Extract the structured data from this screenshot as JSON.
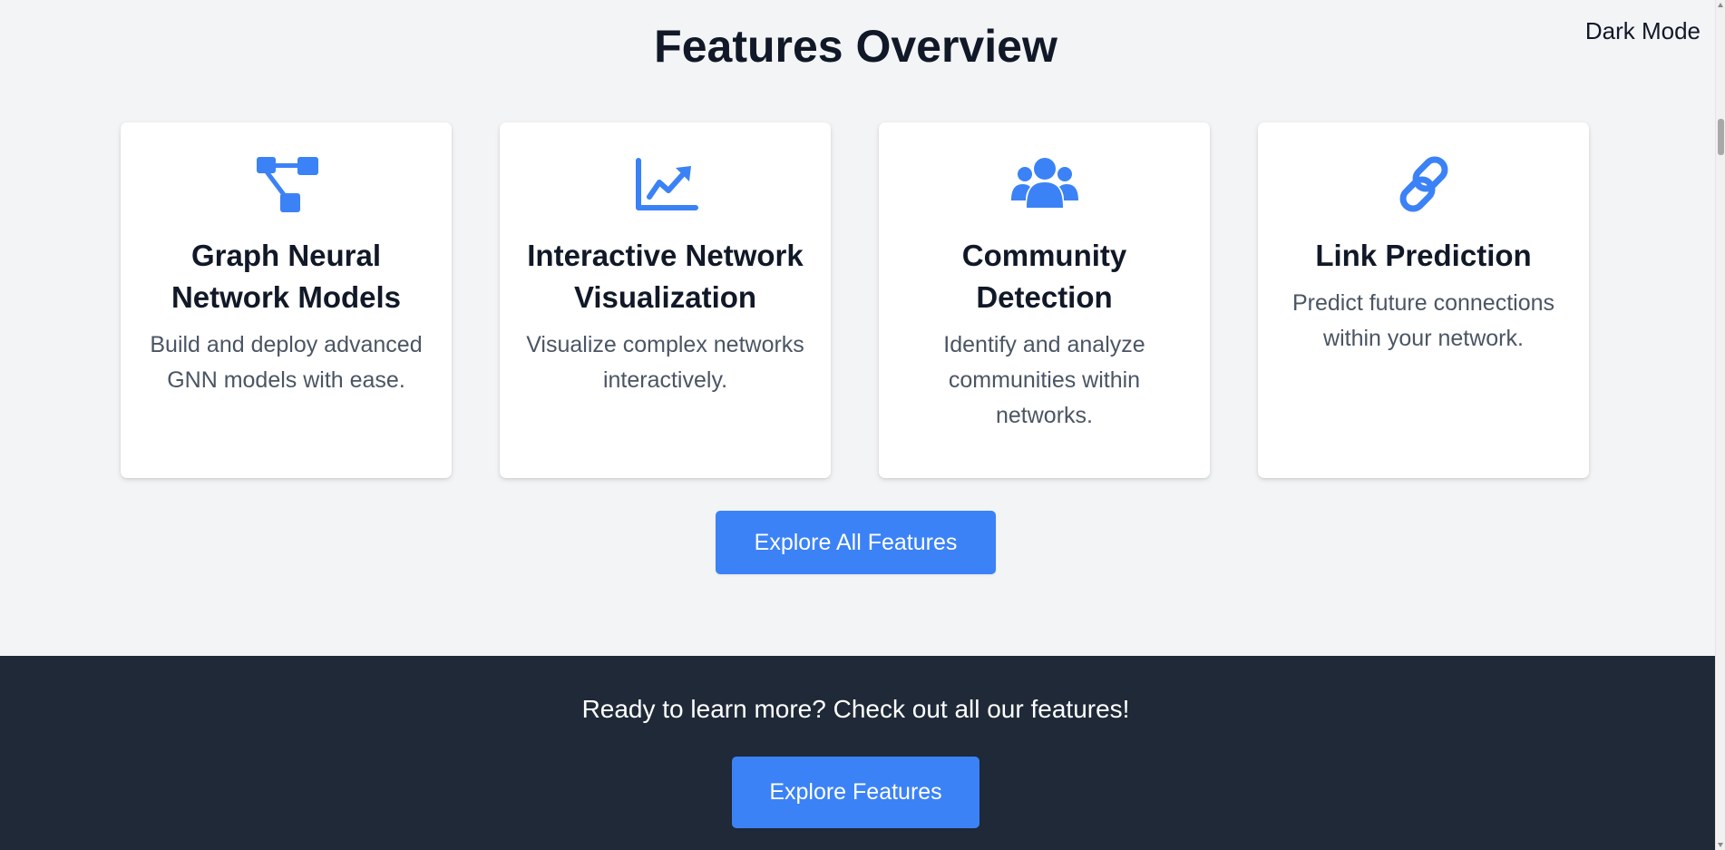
{
  "header": {
    "title": "Features Overview",
    "dark_mode_label": "Dark Mode"
  },
  "features": [
    {
      "icon": "project-diagram-icon",
      "title": "Graph Neural Network Models",
      "description": "Build and deploy advanced GNN models with ease."
    },
    {
      "icon": "chart-line-icon",
      "title": "Interactive Network Visualization",
      "description": "Visualize complex networks interactively."
    },
    {
      "icon": "users-icon",
      "title": "Community Detection",
      "description": "Identify and analyze communities within networks."
    },
    {
      "icon": "link-icon",
      "title": "Link Prediction",
      "description": "Predict future connections within your network."
    }
  ],
  "explore_all_label": "Explore All Features",
  "footer": {
    "text": "Ready to learn more? Check out all our features!",
    "button_label": "Explore Features"
  },
  "colors": {
    "accent": "#3b82f6",
    "page_background": "#f3f4f6",
    "footer_background": "#1f2937"
  }
}
